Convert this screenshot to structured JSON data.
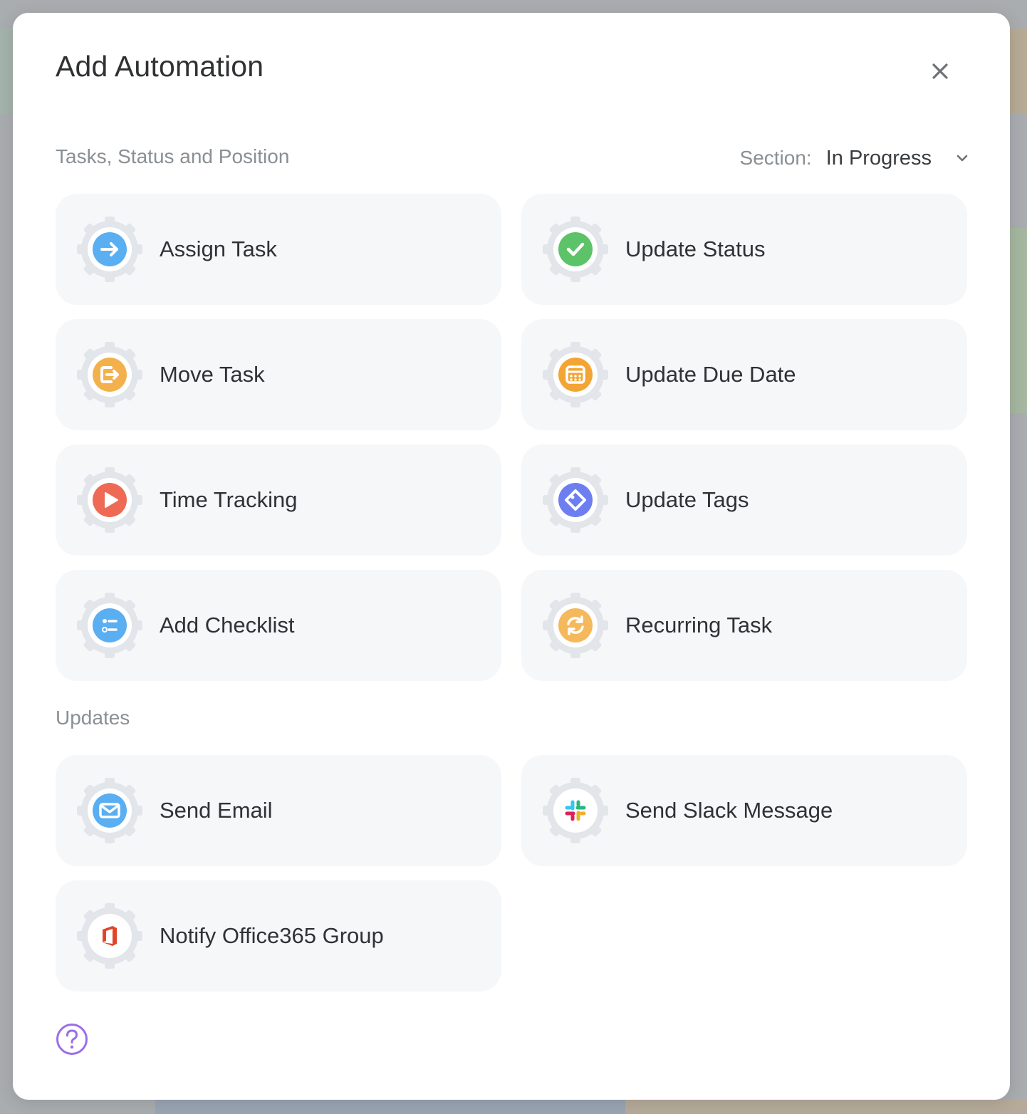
{
  "modal": {
    "title": "Add Automation"
  },
  "section1": {
    "heading": "Tasks, Status and Position",
    "selector_label": "Section:",
    "selector_value": "In Progress"
  },
  "section2": {
    "heading": "Updates"
  },
  "tasks": [
    {
      "label": "Assign Task",
      "icon": "arrow-right-icon",
      "color": "#5aaef2"
    },
    {
      "label": "Update Status",
      "icon": "checkmark-icon",
      "color": "#5cc368"
    },
    {
      "label": "Move Task",
      "icon": "move-exit-icon",
      "color": "#f3b14d"
    },
    {
      "label": "Update Due Date",
      "icon": "calendar-icon",
      "color": "#f2a534"
    },
    {
      "label": "Time Tracking",
      "icon": "play-icon",
      "color": "#ee6a55"
    },
    {
      "label": "Update Tags",
      "icon": "tag-icon",
      "color": "#6c7ef0"
    },
    {
      "label": "Add Checklist",
      "icon": "checklist-icon",
      "color": "#5aaef2"
    },
    {
      "label": "Recurring Task",
      "icon": "recurring-icon",
      "color": "#f5b85a"
    }
  ],
  "updates": [
    {
      "label": "Send Email",
      "icon": "envelope-icon",
      "color": "#5aaef2"
    },
    {
      "label": "Send Slack Message",
      "icon": "slack-icon",
      "color": "#ffffff"
    },
    {
      "label": "Notify Office365 Group",
      "icon": "office365-icon",
      "color": "#ffffff"
    }
  ],
  "colors": {
    "gear": "#e2e5e9",
    "help": "#9b6ee8",
    "office": "#e0452a"
  }
}
